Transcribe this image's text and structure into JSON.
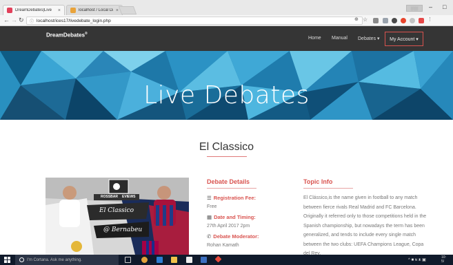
{
  "browser": {
    "tabs": [
      {
        "label": "DreamDebates|Live",
        "active": true,
        "favicon_color": "#e2405a"
      },
      {
        "label": "localhost / Local Databa",
        "active": false,
        "favicon_color": "#e9a33a"
      }
    ],
    "profile_label": "░░░",
    "url": "localhost/ices17/livedebate_login.php",
    "nav_icons": [
      "back-icon",
      "forward-icon",
      "reload-icon"
    ]
  },
  "site": {
    "brand": "DreamDebates",
    "brand_mark": "®",
    "nav": {
      "home": "Home",
      "manual": "Manual",
      "debates": "Debates ▾",
      "account": "My Account ▾"
    },
    "hero_title": "Live Debates",
    "heading": "El Classico",
    "poster": {
      "banner_left": "ROSSBAR",
      "banner_right": "EVIEWS",
      "script1": "El Classico",
      "script2": "@ Bernabeu"
    },
    "debate_details": {
      "title": "Debate Details",
      "fee_label": "Registration Fee:",
      "fee_value": "Free",
      "date_label": "Date and Timing:",
      "date_value": "27th April 2017 2pm",
      "moderator_label": "Debate Moderator:",
      "moderator_value": "Rohan Kamath"
    },
    "topic_info": {
      "title": "Topic Info",
      "text": "El Clássico,is the name given in football to any match between fierce rivals Real Madrid and FC Barcelona. Originally it referred only to those competitions held in the Spanish championship, but nowadays the term has been generalized, and tends to include every single match between the two clubs: UEFA Champions League, Copa del Rey,"
    },
    "colors": {
      "accent": "#d9534f",
      "navbar": "#353535",
      "hero_blue": "#1f84b3"
    }
  },
  "taskbar": {
    "cortana_placeholder": "I'm Cortana. Ask me anything.",
    "tray_text": "^ ■ ɴ ᴥ ▣",
    "clock_time": "10:",
    "clock_date": "5/"
  }
}
